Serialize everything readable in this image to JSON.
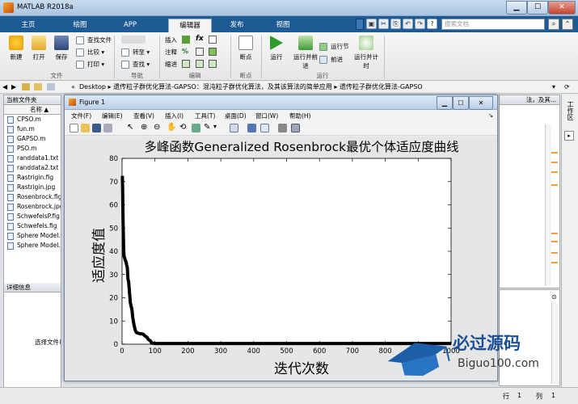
{
  "window": {
    "title": "MATLAB R2018a",
    "min": "▁",
    "max": "☐",
    "close": "✕"
  },
  "tabs": [
    {
      "label": "主页"
    },
    {
      "label": "绘图"
    },
    {
      "label": "APP"
    },
    {
      "label": "编辑器"
    },
    {
      "label": "发布"
    },
    {
      "label": "视图"
    }
  ],
  "search": {
    "placeholder": "搜索文档"
  },
  "ribbon": {
    "new": "新建",
    "open": "打开",
    "save": "保存",
    "find_files": "查找文件",
    "compare": "比较",
    "print": "打印",
    "goto": "转至",
    "find": "查找",
    "insert": "插入",
    "comment": "注释",
    "indent": "缩进",
    "fx": "fx",
    "breakpoint": "断点",
    "run": "运行",
    "run_advance": "运行并前进",
    "run_section": "运行节",
    "advance": "前进",
    "run_time": "运行并计时",
    "groups": {
      "file": "文件",
      "nav": "导航",
      "edit": "编辑",
      "breakpoint": "断点",
      "run": "运行"
    }
  },
  "address": {
    "prefix": "«",
    "path": "Desktop ▸ 遗传粒子群优化算法-GAPSO：混沌粒子群优化算法，及其该算法的简单应用 ▸ 遗传粒子群优化算法-GAPSO",
    "tail": "法，及其..."
  },
  "left_panel": {
    "title": "当前文件夹",
    "col_name": "名称",
    "sort": "▲",
    "files": [
      "CPSO.m",
      "fun.m",
      "GAPSO.m",
      "PSO.m",
      "randdata1.txt",
      "randdata2.txt",
      "Rastrigin.fig",
      "Rastrigin.jpg",
      "Rosenbrock.fig",
      "Rosenbrock.jpg",
      "SchwefelsP.fig",
      "Schwefels.fig",
      "Sphere Model.fig",
      "Sphere Model.jpg"
    ],
    "details": "详细信息",
    "select_msg": "选择文件以查看详细信息"
  },
  "right_panel": {
    "label": "工作区"
  },
  "status": {
    "row_label": "行",
    "row": "1",
    "col_label": "列",
    "col": "1"
  },
  "figure": {
    "title": "Figure 1",
    "menu": [
      "文件(F)",
      "编辑(E)",
      "查看(V)",
      "插入(I)",
      "工具(T)",
      "桌面(D)",
      "窗口(W)",
      "帮助(H)"
    ],
    "collapse": "↘"
  },
  "chart_data": {
    "type": "line",
    "title": "多峰函数Generalized Rosenbrock最优个体适应度曲线",
    "xlabel": "迭代次数",
    "ylabel": "适应度值",
    "xlim": [
      0,
      1000
    ],
    "ylim": [
      0,
      80
    ],
    "xticks": [
      0,
      100,
      200,
      300,
      400,
      500,
      600,
      700,
      800,
      900,
      1000
    ],
    "yticks": [
      0,
      10,
      20,
      30,
      40,
      50,
      60,
      70,
      80
    ],
    "grid": false,
    "series": [
      {
        "color": "#000000",
        "x": [
          1,
          2,
          3,
          4,
          5,
          6,
          8,
          10,
          12,
          14,
          16,
          18,
          20,
          22,
          25,
          28,
          30,
          33,
          36,
          40,
          44,
          48,
          52,
          56,
          60,
          64,
          70,
          76,
          80,
          86,
          90,
          95,
          100,
          120,
          200,
          300,
          400,
          500,
          600,
          700,
          800,
          900,
          1000
        ],
        "y": [
          72.5,
          65,
          54,
          47,
          41,
          38,
          37,
          36,
          35.5,
          34,
          33,
          28,
          27,
          23,
          18,
          16,
          15,
          11,
          8.5,
          6,
          5,
          4.8,
          4.6,
          4.5,
          4.5,
          4.3,
          3.5,
          3,
          2,
          1.5,
          0.5,
          0.4,
          0.3,
          0.3,
          0.3,
          0.3,
          0.3,
          0.3,
          0.3,
          0.3,
          0.3,
          0.3,
          0.3
        ]
      }
    ]
  },
  "watermark": {
    "brand": "必过源码",
    "domain": "Biguo100.com"
  }
}
